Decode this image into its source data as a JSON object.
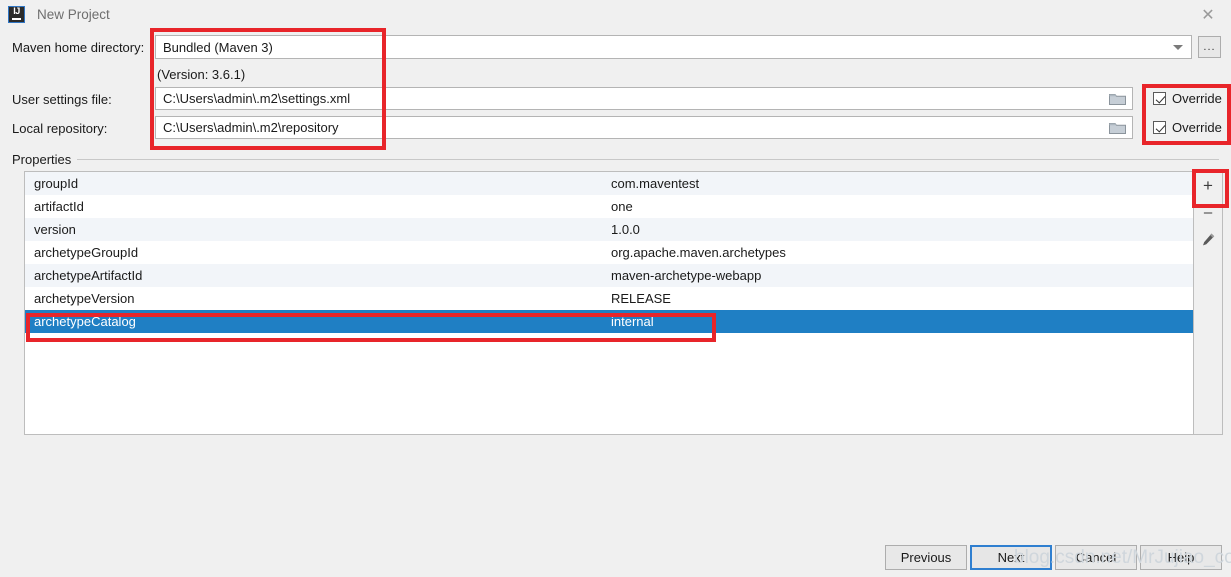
{
  "window": {
    "title": "New Project",
    "app_icon": "intellij-idea-icon",
    "close_icon": "close-icon"
  },
  "form": {
    "maven_home": {
      "label": "Maven home directory:",
      "value": "Bundled (Maven 3)",
      "dropdown_icon": "chevron-down-icon",
      "browse_label": "...",
      "version_note": "(Version: 3.6.1)"
    },
    "user_settings": {
      "label": "User settings file:",
      "value": "C:\\Users\\admin\\.m2\\settings.xml",
      "browse_icon": "folder-icon",
      "override_label": "Override",
      "override_checked": true
    },
    "local_repository": {
      "label": "Local repository:",
      "value": "C:\\Users\\admin\\.m2\\repository",
      "browse_icon": "folder-icon",
      "override_label": "Override",
      "override_checked": true
    }
  },
  "properties": {
    "group_label": "Properties",
    "rows": [
      {
        "key": "groupId",
        "value": "com.maventest"
      },
      {
        "key": "artifactId",
        "value": "one"
      },
      {
        "key": "version",
        "value": "1.0.0"
      },
      {
        "key": "archetypeGroupId",
        "value": "org.apache.maven.archetypes"
      },
      {
        "key": "archetypeArtifactId",
        "value": "maven-archetype-webapp"
      },
      {
        "key": "archetypeVersion",
        "value": "RELEASE"
      },
      {
        "key": "archetypeCatalog",
        "value": "internal"
      }
    ],
    "selected_index": 6,
    "toolbar": {
      "add_label": "+",
      "remove_label": "–",
      "edit_icon": "pencil-icon"
    }
  },
  "footer": {
    "previous_label": "Previous",
    "next_label": "Next",
    "cancel_label": "Cancel",
    "help_label": "Help"
  },
  "watermark": {
    "text": "blog.csdn.net/MrJujiao_code"
  },
  "colors": {
    "selection_blue": "#1f7fc4",
    "annotation_red": "#e8252a",
    "dialog_bg": "#f0f0f0"
  }
}
